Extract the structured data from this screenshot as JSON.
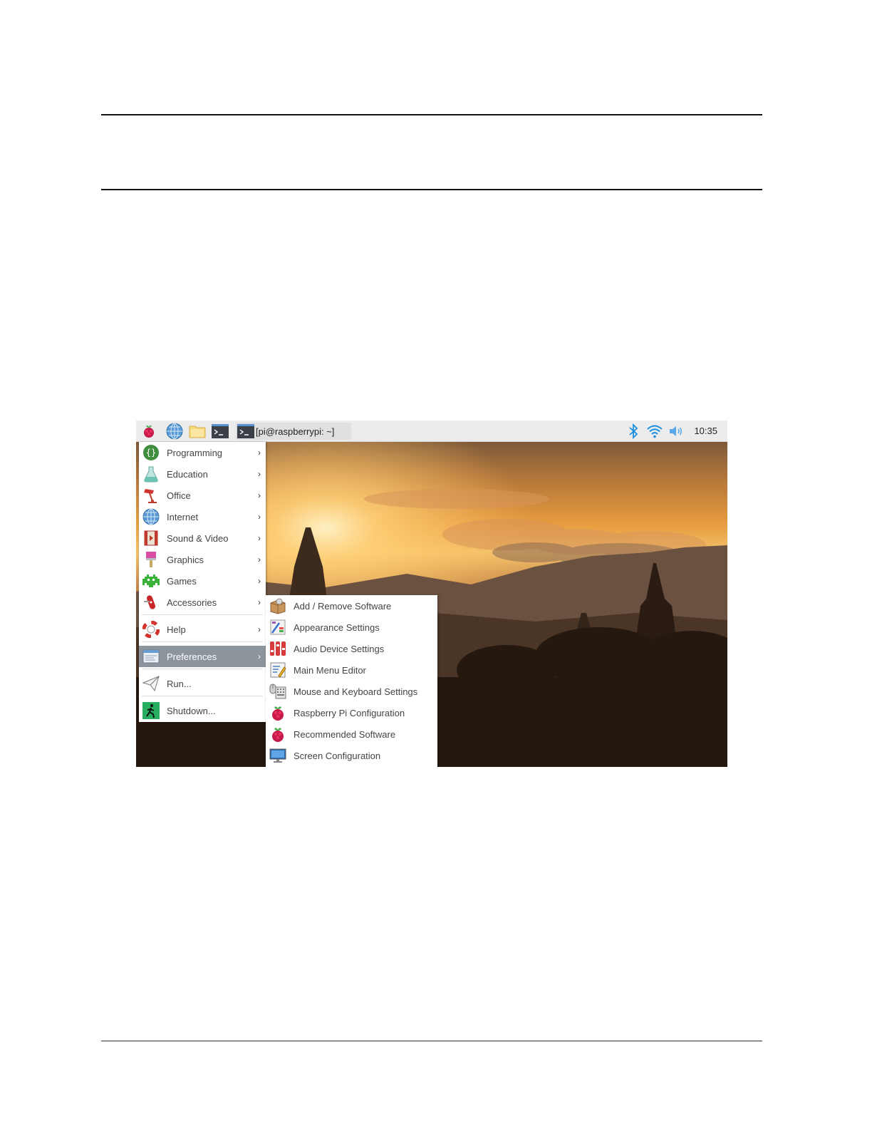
{
  "taskbar": {
    "launchers": [
      {
        "name": "raspberry-menu",
        "icon": "raspberry-icon"
      },
      {
        "name": "web-browser",
        "icon": "globe-icon"
      },
      {
        "name": "file-manager",
        "icon": "folder-icon"
      },
      {
        "name": "terminal",
        "icon": "terminal-icon"
      }
    ],
    "window_button": {
      "label": "[pi@raspberrypi: ~]",
      "icon": "terminal-icon"
    },
    "tray": {
      "icons": [
        "bluetooth-icon",
        "wifi-icon",
        "volume-icon"
      ],
      "clock": "10:35"
    }
  },
  "menu": {
    "items": [
      {
        "label": "Programming",
        "icon": "programming-icon",
        "submenu": true
      },
      {
        "label": "Education",
        "icon": "education-icon",
        "submenu": true
      },
      {
        "label": "Office",
        "icon": "office-icon",
        "submenu": true
      },
      {
        "label": "Internet",
        "icon": "globe-icon",
        "submenu": true
      },
      {
        "label": "Sound & Video",
        "icon": "sound-video-icon",
        "submenu": true
      },
      {
        "label": "Graphics",
        "icon": "graphics-icon",
        "submenu": true
      },
      {
        "label": "Games",
        "icon": "games-icon",
        "submenu": true
      },
      {
        "label": "Accessories",
        "icon": "accessories-icon",
        "submenu": true
      },
      {
        "label": "Help",
        "icon": "lifebuoy-icon",
        "submenu": true
      },
      {
        "label": "Preferences",
        "icon": "preferences-icon",
        "submenu": true,
        "selected": true
      },
      {
        "label": "Run...",
        "icon": "paper-plane-icon",
        "submenu": false
      },
      {
        "label": "Shutdown...",
        "icon": "exit-icon",
        "submenu": false
      }
    ],
    "chevron": "›"
  },
  "submenu": {
    "items": [
      {
        "label": "Add / Remove Software",
        "icon": "package-icon"
      },
      {
        "label": "Appearance Settings",
        "icon": "appearance-icon"
      },
      {
        "label": "Audio Device Settings",
        "icon": "audio-mixer-icon"
      },
      {
        "label": "Main Menu Editor",
        "icon": "menu-editor-icon"
      },
      {
        "label": "Mouse and Keyboard Settings",
        "icon": "keyboard-mouse-icon"
      },
      {
        "label": "Raspberry Pi Configuration",
        "icon": "raspberry-icon"
      },
      {
        "label": "Recommended Software",
        "icon": "raspberry-icon"
      },
      {
        "label": "Screen Configuration",
        "icon": "monitor-icon"
      }
    ]
  },
  "colors": {
    "menu_selected": "#8c949c",
    "taskbar": "#ececec",
    "tray_icons": "#1a8fe0"
  }
}
